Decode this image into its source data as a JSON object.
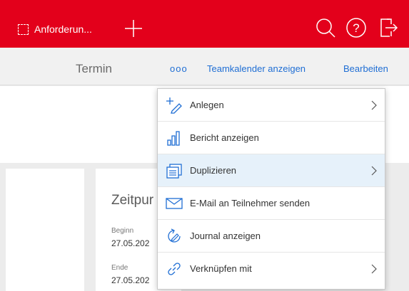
{
  "header": {
    "app_label": "Anforderun...",
    "accent_color": "#e3001b",
    "icons": [
      "app-square-icon",
      "plus-icon",
      "search-icon",
      "help-icon",
      "logout-icon"
    ]
  },
  "subbar": {
    "title": "Termin",
    "more_label": "ooo",
    "team_calendar_label": "Teamkalender anzeigen",
    "edit_label": "Bearbeiten"
  },
  "card": {
    "title": "Zeitpur",
    "begin_label": "Beginn",
    "begin_value": "27.05.202",
    "end_label": "Ende",
    "end_value": "27.05.202"
  },
  "menu": {
    "items": [
      {
        "label": "Anlegen",
        "icon": "create-icon",
        "has_submenu": true
      },
      {
        "label": "Bericht anzeigen",
        "icon": "bar-chart-icon",
        "has_submenu": false
      },
      {
        "label": "Duplizieren",
        "icon": "duplicate-icon",
        "has_submenu": true,
        "selected": true
      },
      {
        "label": "E-Mail an Teilnehmer senden",
        "icon": "mail-icon",
        "has_submenu": false
      },
      {
        "label": "Journal anzeigen",
        "icon": "journal-icon",
        "has_submenu": false
      },
      {
        "label": "Verknüpfen mit",
        "icon": "link-icon",
        "has_submenu": true
      }
    ]
  }
}
